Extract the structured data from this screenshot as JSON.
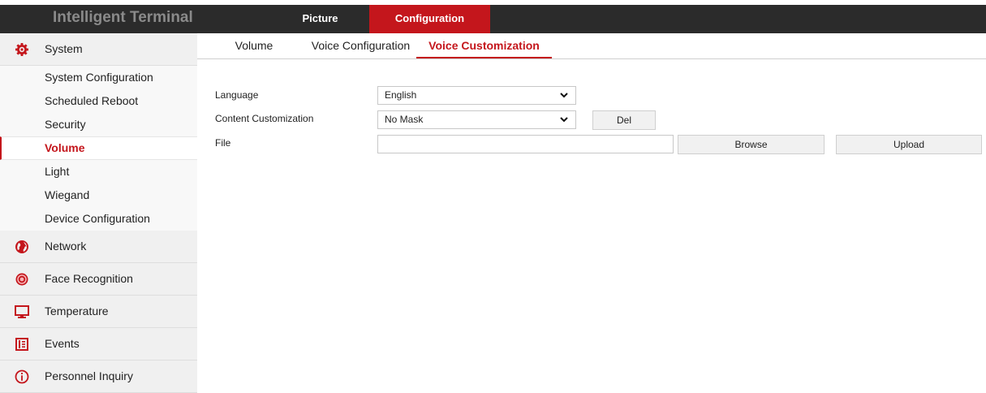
{
  "header": {
    "brand": "Intelligent Terminal",
    "tabs": [
      {
        "label": "Picture",
        "active": false
      },
      {
        "label": "Configuration",
        "active": true
      }
    ]
  },
  "colors": {
    "accent": "#c4161c",
    "topbar": "#2b2b2b"
  },
  "sidebar": {
    "system": {
      "label": "System",
      "icon": "gear-icon"
    },
    "sub_items": [
      {
        "label": "System Configuration"
      },
      {
        "label": "Scheduled Reboot"
      },
      {
        "label": "Security"
      },
      {
        "label": "Volume",
        "active": true
      },
      {
        "label": "Light"
      },
      {
        "label": "Wiegand"
      },
      {
        "label": "Device Configuration"
      }
    ],
    "categories": [
      {
        "label": "Network",
        "icon": "globe-icon"
      },
      {
        "label": "Face Recognition",
        "icon": "face-recognition-icon"
      },
      {
        "label": "Temperature",
        "icon": "monitor-icon"
      },
      {
        "label": "Events",
        "icon": "events-icon"
      },
      {
        "label": "Personnel Inquiry",
        "icon": "info-icon"
      }
    ]
  },
  "content": {
    "tabs": [
      {
        "label": "Volume"
      },
      {
        "label": "Voice Configuration"
      },
      {
        "label": "Voice Customization",
        "active": true
      }
    ],
    "form": {
      "language_label": "Language",
      "language_value": "English",
      "content_label": "Content Customization",
      "content_value": "No Mask",
      "del_label": "Del",
      "file_label": "File",
      "file_value": "",
      "browse_label": "Browse",
      "upload_label": "Upload"
    }
  }
}
